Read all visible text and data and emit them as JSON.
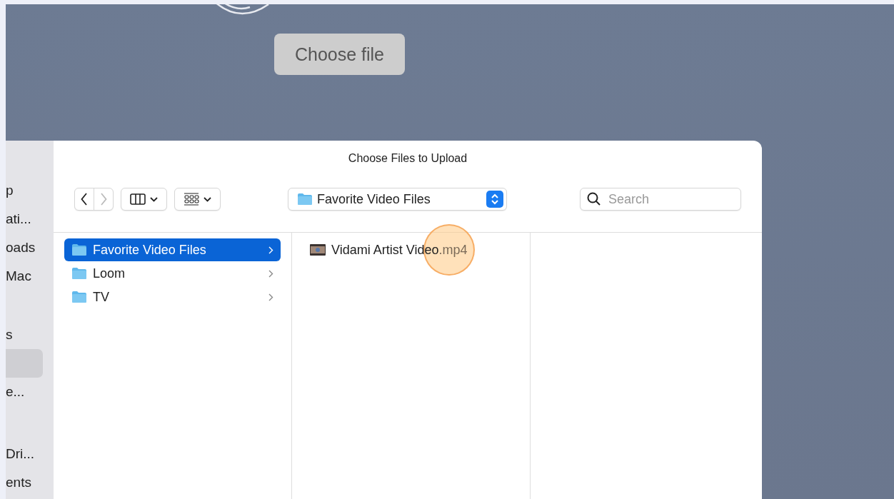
{
  "page": {
    "upload_button": "Choose file"
  },
  "dialog": {
    "title": "Choose Files to Upload",
    "toolbar": {
      "location": "Favorite Video Files",
      "search": {
        "placeholder": "Search"
      }
    },
    "sidebar": {
      "items": [
        {
          "label": "p",
          "selected": false
        },
        {
          "label": "ati...",
          "selected": false
        },
        {
          "label": "oads",
          "selected": false
        },
        {
          "label": "Mac",
          "selected": false
        },
        {
          "label": "s",
          "selected": false
        },
        {
          "selected": true
        },
        {
          "label": "e...",
          "selected": false
        },
        {
          "label": "Dri...",
          "selected": false
        },
        {
          "label": "ents",
          "selected": false
        }
      ]
    },
    "columns": [
      {
        "items": [
          {
            "kind": "folder",
            "name": "Favorite Video Files",
            "selected": true
          },
          {
            "kind": "folder",
            "name": "Loom",
            "selected": false
          },
          {
            "kind": "folder",
            "name": "TV",
            "selected": false
          }
        ]
      },
      {
        "items": [
          {
            "kind": "video",
            "name": "Vidami Artist Video",
            "extension": ".mp4",
            "selected": false
          }
        ]
      }
    ]
  }
}
